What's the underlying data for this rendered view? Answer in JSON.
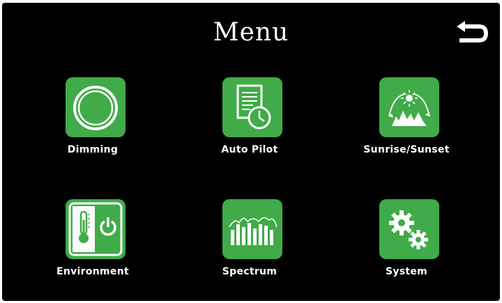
{
  "header": {
    "title": "Menu"
  },
  "icons": {
    "back": "back-arrow-icon"
  },
  "colors": {
    "background": "#000000",
    "tile": "#40ab48",
    "text": "#ffffff"
  },
  "menu": {
    "items": [
      {
        "label": "Dimming",
        "icon": "dimming-knob-icon"
      },
      {
        "label": "Auto Pilot",
        "icon": "auto-pilot-schedule-icon"
      },
      {
        "label": "Sunrise/Sunset",
        "icon": "sunrise-sunset-icon"
      },
      {
        "label": "Environment",
        "icon": "environment-thermometer-power-icon"
      },
      {
        "label": "Spectrum",
        "icon": "spectrum-bars-icon"
      },
      {
        "label": "System",
        "icon": "system-gears-icon"
      }
    ]
  }
}
